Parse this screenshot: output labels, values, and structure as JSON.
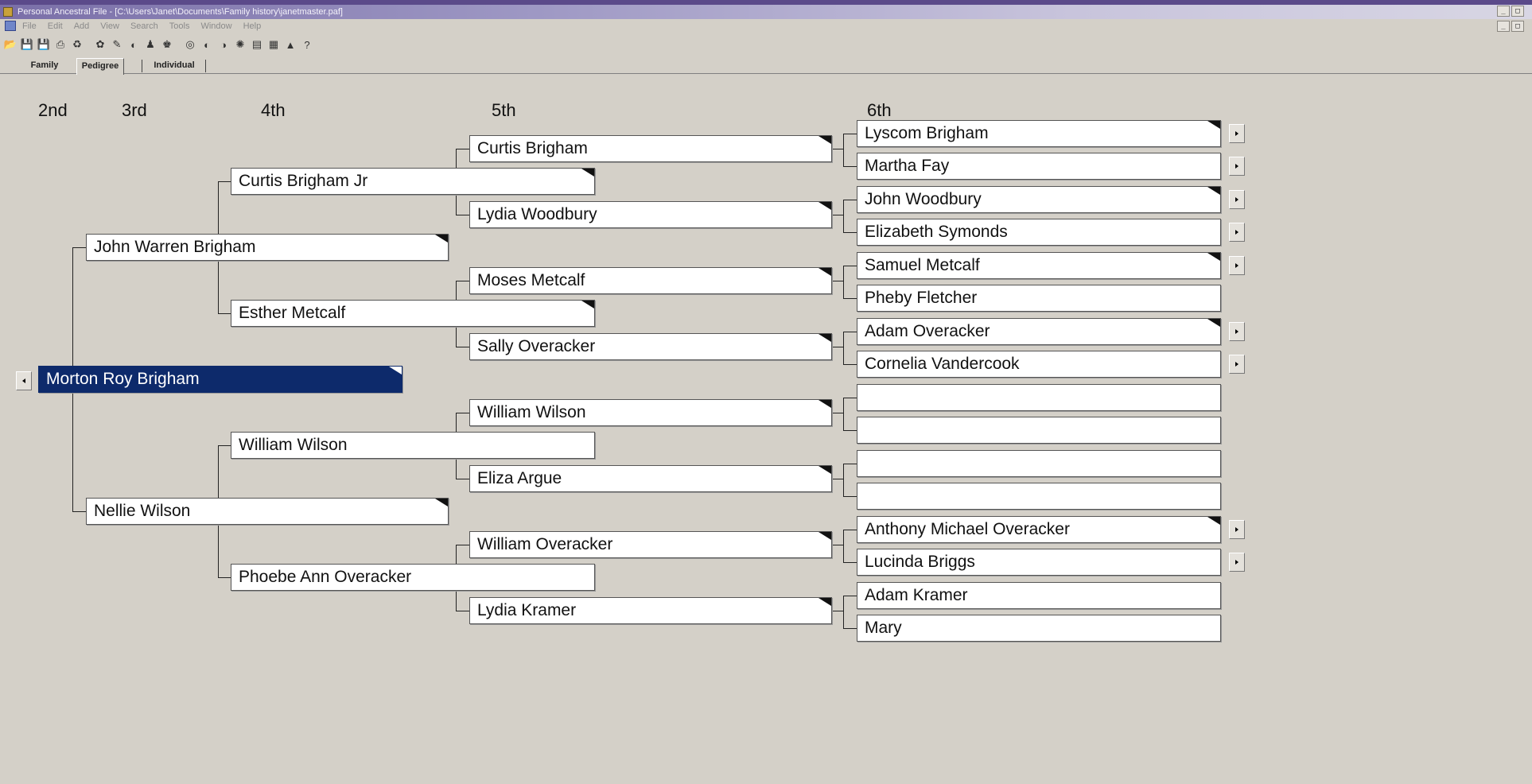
{
  "window": {
    "title": "Personal Ancestral File - [C:\\Users\\Janet\\Documents\\Family history\\janetmaster.paf]",
    "controls": [
      "_",
      "□"
    ]
  },
  "menu": [
    "File",
    "Edit",
    "Add",
    "View",
    "Search",
    "Tools",
    "Window",
    "Help"
  ],
  "toolbar_icons": [
    "open-file-icon",
    "save-icon",
    "save-as-icon",
    "print-icon",
    "backup-icon",
    "research-icon",
    "notes-icon",
    "camera-icon",
    "family-icon",
    "pedigree-icon",
    "find-icon",
    "find-next-icon",
    "find-prev-icon",
    "merge-icon",
    "index-icon",
    "map-icon",
    "chart-icon",
    "help-icon"
  ],
  "tabs": [
    "Family",
    "Pedigree",
    "Individual"
  ],
  "active_tab": "Pedigree",
  "generations": [
    "2nd",
    "3rd",
    "4th",
    "5th",
    "6th"
  ],
  "pedigree": {
    "root": "Morton Roy Brigham",
    "gen3": [
      "John Warren Brigham",
      "Nellie Wilson"
    ],
    "gen4": [
      "Curtis Brigham Jr",
      "Esther Metcalf",
      "William Wilson",
      "Phoebe Ann Overacker"
    ],
    "gen5": [
      "Curtis Brigham",
      "Lydia Woodbury",
      "Moses Metcalf",
      "Sally Overacker",
      "William Wilson",
      "Eliza Argue",
      "William Overacker",
      "Lydia Kramer"
    ],
    "gen6": [
      "Lyscom Brigham",
      "Martha Fay",
      "John Woodbury",
      "Elizabeth Symonds",
      "Samuel Metcalf",
      "Pheby Fletcher",
      "Adam Overacker",
      "Cornelia Vandercook",
      "",
      "",
      "",
      "",
      "Anthony Michael Overacker",
      "Lucinda Briggs",
      "Adam Kramer",
      "Mary"
    ]
  }
}
